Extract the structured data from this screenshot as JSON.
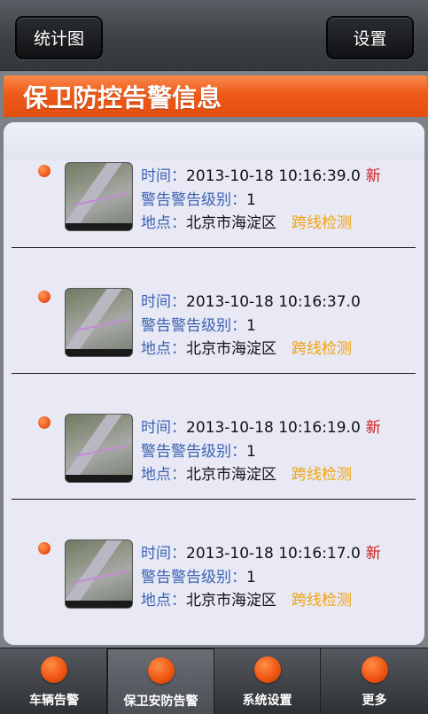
{
  "header": {
    "left_button": "统计图",
    "right_button": "设置"
  },
  "page_title": "保卫防控告警信息",
  "labels": {
    "time": "时间：",
    "level": "警告警告级别：",
    "location": "地点："
  },
  "alerts": [
    {
      "time": "2013-10-18 10:16:39.0",
      "is_new": "新",
      "level": "1",
      "location": "北京市海淀区",
      "type": "跨线检测"
    },
    {
      "time": "2013-10-18 10:16:37.0",
      "is_new": "",
      "level": "1",
      "location": "北京市海淀区",
      "type": "跨线检测"
    },
    {
      "time": "2013-10-18 10:16:19.0",
      "is_new": "新",
      "level": "1",
      "location": "北京市海淀区",
      "type": "跨线检测"
    },
    {
      "time": "2013-10-18 10:16:17.0",
      "is_new": "新",
      "level": "1",
      "location": "北京市海淀区",
      "type": "跨线检测"
    }
  ],
  "tabs": [
    {
      "label": "车辆告警",
      "selected": false
    },
    {
      "label": "保卫安防告警",
      "selected": true
    },
    {
      "label": "系统设置",
      "selected": false
    },
    {
      "label": "更多",
      "selected": false
    }
  ],
  "colors": {
    "accent": "#ee5a18",
    "label_blue": "#3b63b3",
    "new_red": "#d01c1c",
    "tag_orange": "#f2a20c"
  }
}
